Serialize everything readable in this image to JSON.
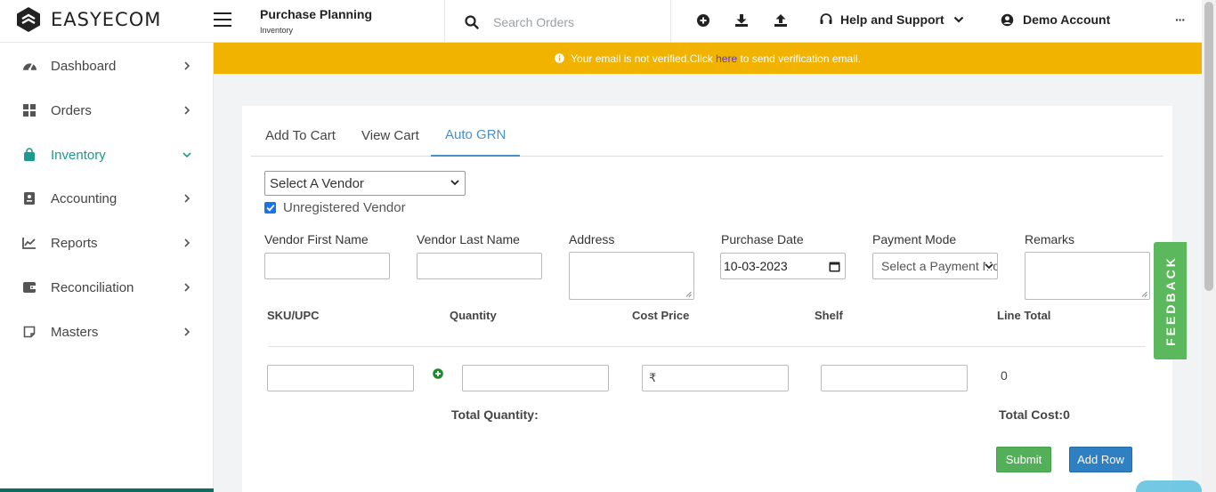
{
  "brand": {
    "name": "EASYECOM"
  },
  "header": {
    "title": "Purchase Planning",
    "subtitle": "Inventory",
    "search_placeholder": "Search Orders",
    "help_label": "Help and Support",
    "account_label": "Demo Account",
    "more_label": "···",
    "icons": [
      "plus-circle-icon",
      "download-icon",
      "upload-icon",
      "headset-icon",
      "chevron-down-icon",
      "user-circle-icon",
      "more-icon"
    ]
  },
  "sidebar": {
    "items": [
      {
        "label": "Dashboard",
        "icon": "dashboard-icon",
        "active": false
      },
      {
        "label": "Orders",
        "icon": "grid-icon",
        "active": false
      },
      {
        "label": "Inventory",
        "icon": "shopping-bag-icon",
        "active": true
      },
      {
        "label": "Accounting",
        "icon": "ledger-icon",
        "active": false
      },
      {
        "label": "Reports",
        "icon": "chart-line-icon",
        "active": false
      },
      {
        "label": "Reconciliation",
        "icon": "wallet-icon",
        "active": false
      },
      {
        "label": "Masters",
        "icon": "note-icon",
        "active": false
      }
    ],
    "active_color": "#1a9b8f"
  },
  "banner": {
    "text_before": "Your email is not verified.Click ",
    "link_text": "here",
    "text_after": " to send verification email.",
    "color": "#f2b200"
  },
  "tabs": [
    {
      "label": "Add To Cart",
      "active": false
    },
    {
      "label": "View Cart",
      "active": false
    },
    {
      "label": "Auto GRN",
      "active": true
    }
  ],
  "form": {
    "vendor_select": "Select A Vendor",
    "unregistered_label": "Unregistered Vendor",
    "unregistered_checked": true,
    "fields": {
      "first_name": "Vendor First Name",
      "last_name": "Vendor Last Name",
      "address": "Address",
      "purchase_date": "Purchase Date",
      "payment_mode": "Payment Mode",
      "remarks": "Remarks"
    },
    "purchase_date_value": "10-03-2023",
    "payment_mode_value": "Select a Payment Mode"
  },
  "table": {
    "columns": [
      "SKU/UPC",
      "Quantity",
      "Cost Price",
      "Shelf",
      "Line Total"
    ],
    "row": {
      "cost_prefix": "₹",
      "line_total": "0"
    },
    "total_quantity_label": "Total Quantity:",
    "total_cost_label": "Total Cost:0"
  },
  "buttons": {
    "submit": "Submit",
    "add_row": "Add Row"
  },
  "feedback_label": "FEEDBACK",
  "colors": {
    "accent": "#4a90c8",
    "submit": "#54b058",
    "add_row": "#2f7fc3",
    "feedback": "#5cb85c"
  }
}
